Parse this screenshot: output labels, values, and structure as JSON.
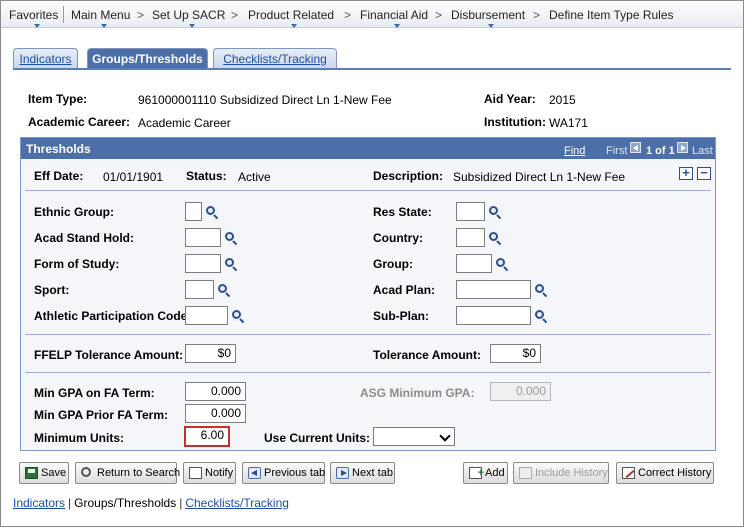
{
  "breadcrumb": {
    "items": [
      "Favorites",
      "Main Menu",
      "Set Up SACR",
      "Product Related",
      "Financial Aid",
      "Disbursement",
      "Define Item Type Rules"
    ],
    "separator": ">"
  },
  "tabs": [
    {
      "label": "Indicators",
      "active": false
    },
    {
      "label": "Groups/Thresholds",
      "active": true
    },
    {
      "label": "Checklists/Tracking",
      "active": false
    }
  ],
  "header": {
    "item_type_label": "Item Type:",
    "item_type_value": "961000001110 Subsidized Direct Ln 1-New Fee",
    "aid_year_label": "Aid Year:",
    "aid_year_value": "2015",
    "career_label": "Academic Career:",
    "career_value": "Academic Career",
    "institution_label": "Institution:",
    "institution_value": "WA171"
  },
  "thresholds": {
    "title": "Thresholds",
    "find": "Find",
    "first": "First",
    "range": "1 of 1",
    "last": "Last",
    "eff_date_label": "Eff Date:",
    "eff_date_value": "01/01/1901",
    "status_label": "Status:",
    "status_value": "Active",
    "description_label": "Description:",
    "description_value": "Subsidized Direct Ln 1-New Fee",
    "add_row": "+",
    "delete_row": "−",
    "fields": {
      "ethnic_group": "Ethnic Group:",
      "acad_stand_hold": "Acad Stand Hold:",
      "form_of_study": "Form of Study:",
      "sport": "Sport:",
      "athletic_code": "Athletic Participation Code:",
      "res_state": "Res State:",
      "country": "Country:",
      "group": "Group:",
      "acad_plan": "Acad Plan:",
      "sub_plan": "Sub-Plan:"
    },
    "ffelp_label": "FFELP Tolerance Amount:",
    "ffelp_value": "$0",
    "tolerance_label": "Tolerance Amount:",
    "tolerance_value": "$0",
    "min_gpa_fa_label": "Min GPA on FA Term:",
    "min_gpa_fa_value": "0.000",
    "asg_gpa_label": "ASG Minimum GPA:",
    "asg_gpa_value": "0.000",
    "min_gpa_prior_label": "Min GPA Prior FA Term:",
    "min_gpa_prior_value": "0.000",
    "min_units_label": "Minimum Units:",
    "min_units_value": "6.00",
    "use_current_label": "Use Current Units:",
    "use_current_value": ""
  },
  "toolbar": {
    "save": "Save",
    "return": "Return to Search",
    "notify": "Notify",
    "prev_tab": "Previous tab",
    "next_tab": "Next tab",
    "add": "Add",
    "include_history": "Include History",
    "correct_history": "Correct History"
  },
  "footer_links": [
    "Indicators",
    "Groups/Thresholds",
    "Checklists/Tracking"
  ],
  "colors": {
    "header_blue": "#4d6fa7",
    "link_blue": "#1f4fa0",
    "highlight_red": "#c43131"
  }
}
